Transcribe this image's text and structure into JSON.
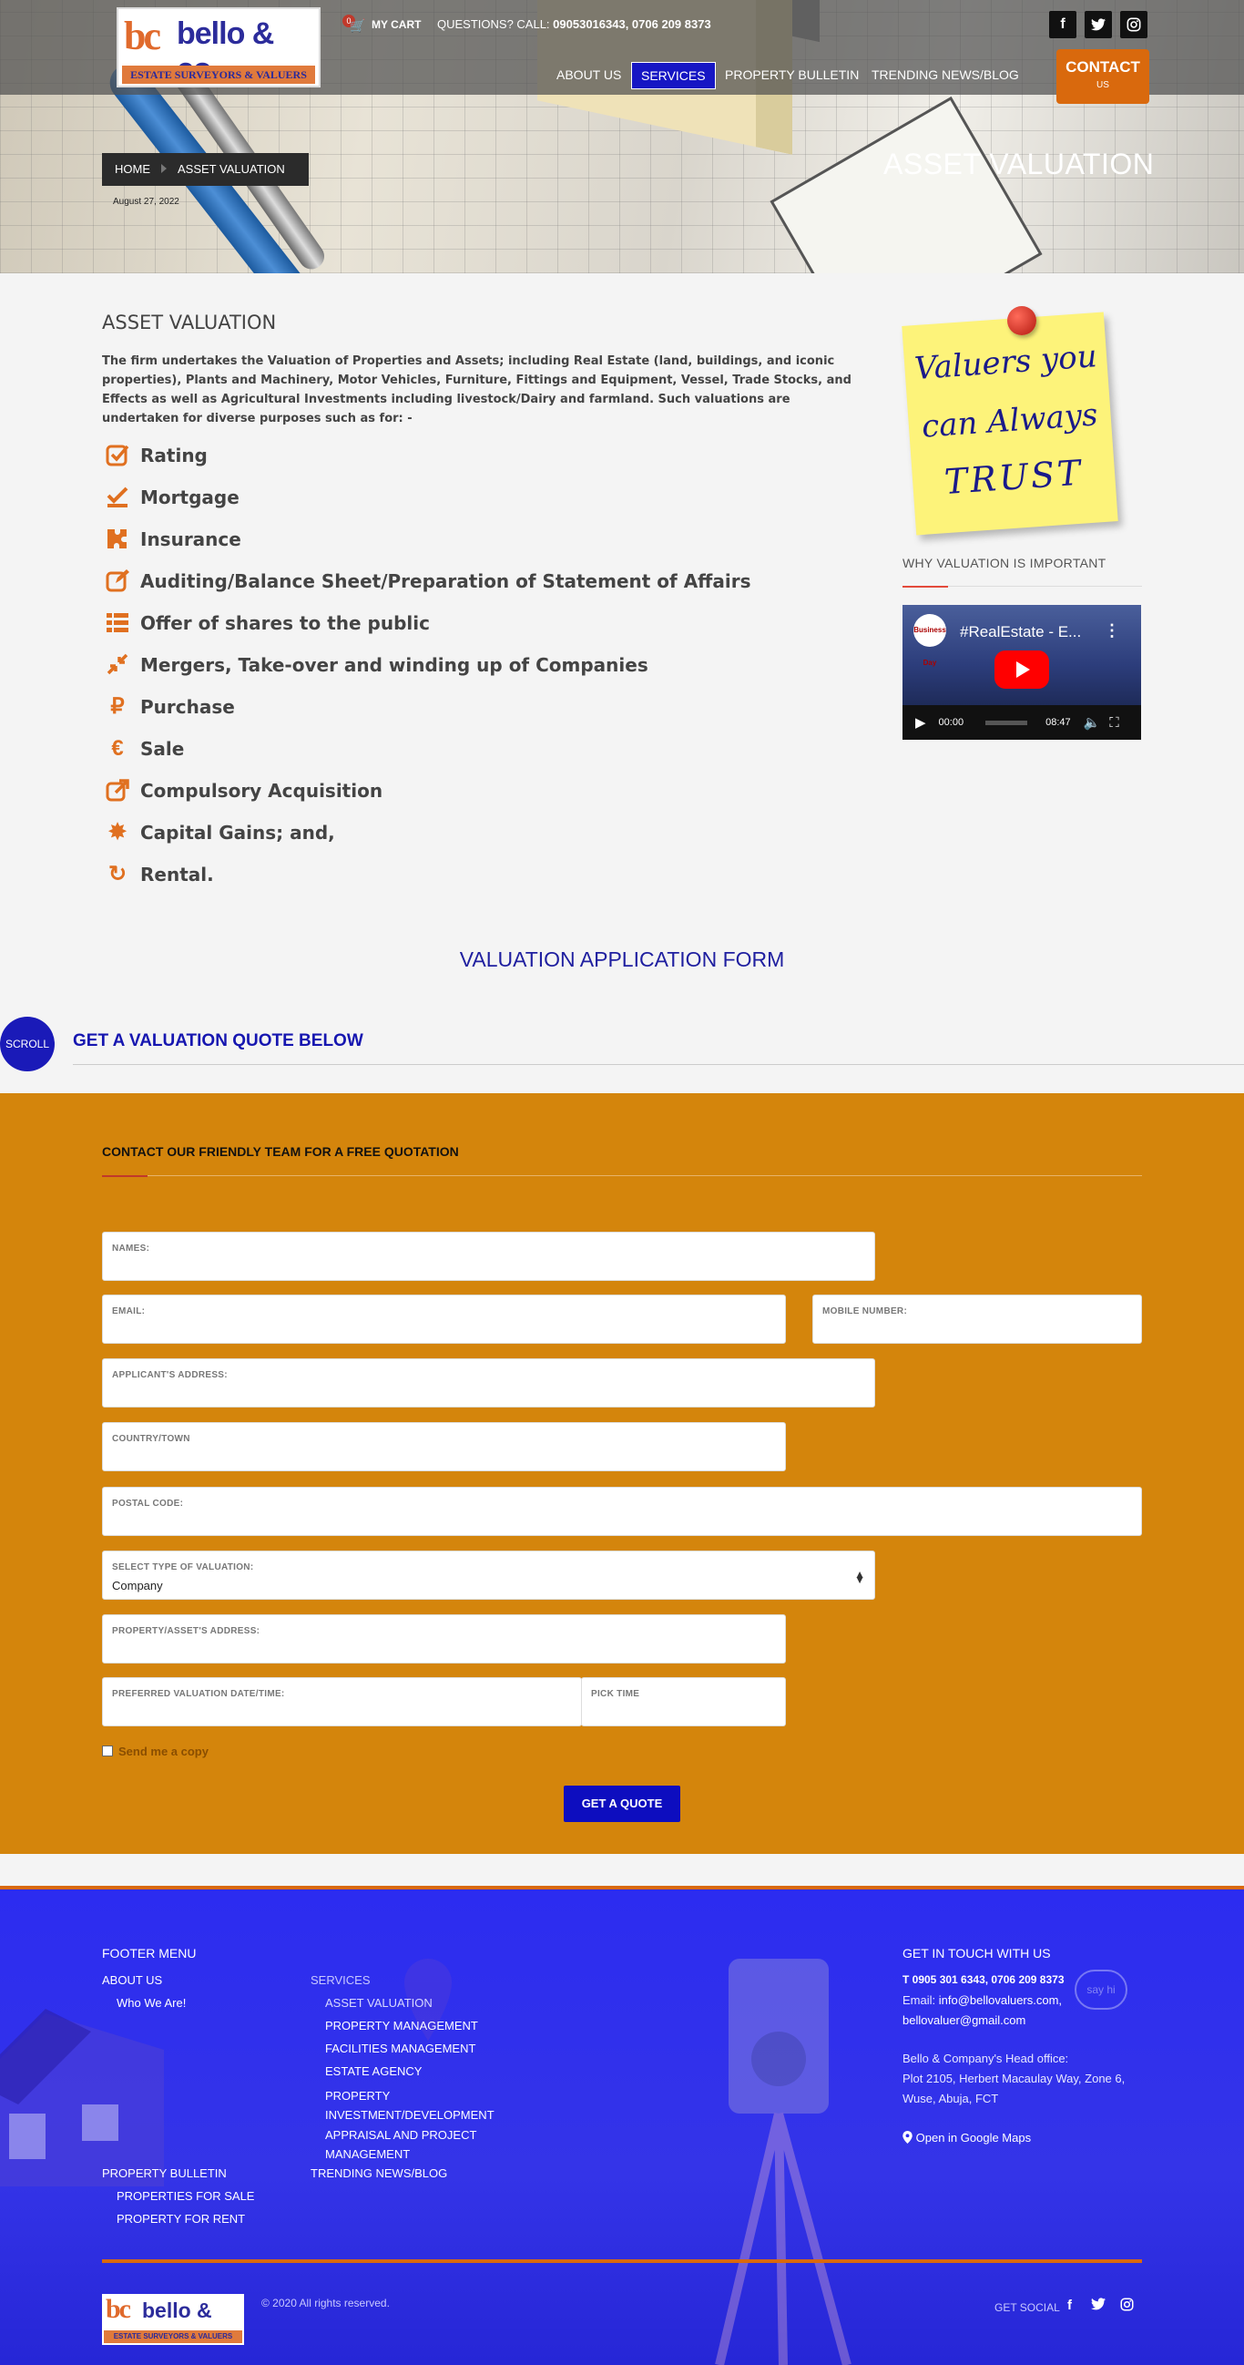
{
  "header": {
    "logo": {
      "monogram": "bc",
      "name": "bello & co.",
      "tagline": "ESTATE SURVEYORS & VALUERS"
    },
    "cart": {
      "count": "0",
      "label": "MY CART"
    },
    "questions_prefix": "QUESTIONS? CALL:",
    "phones": "09053016343, 0706 209 8373",
    "social": [
      "f",
      "t",
      "ig"
    ],
    "nav": [
      "ABOUT US",
      "SERVICES",
      "PROPERTY BULLETIN",
      "TRENDING NEWS/BLOG"
    ],
    "contact_line1": "CONTACT",
    "contact_line2": "US"
  },
  "hero": {
    "breadcrumb": [
      "HOME",
      "ASSET VALUATION"
    ],
    "date": "August 27, 2022",
    "title": "ASSET VALUATION"
  },
  "content": {
    "title": "ASSET VALUATION",
    "intro": "The firm undertakes the Valuation of Properties and Assets; including Real Estate (land, buildings, and iconic properties), Plants and Machinery, Motor Vehicles, Furniture, Fittings and Equipment, Vessel, Trade Stocks, and Effects as well as Agricultural Investments including livestock/Dairy and farmland. Such valuations are undertaken for diverse purposes such as for: -",
    "purposes": [
      {
        "icon": "check-square-icon",
        "text": "Rating"
      },
      {
        "icon": "check-underline-icon",
        "text": "Mortgage"
      },
      {
        "icon": "puzzle-icon",
        "text": "Insurance"
      },
      {
        "icon": "edit-icon",
        "text": "Auditing/Balance Sheet/Preparation of Statement of Affairs"
      },
      {
        "icon": "list-icon",
        "text": "Offer of shares to the public"
      },
      {
        "icon": "compress-icon",
        "text": "Mergers, Take-over and winding up of Companies"
      },
      {
        "icon": "ruble-icon",
        "text": "Purchase"
      },
      {
        "icon": "euro-icon",
        "text": "Sale"
      },
      {
        "icon": "share-square-icon",
        "text": "Compulsory Acquisition"
      },
      {
        "icon": "asterisk-icon",
        "text": "Capital Gains; and,"
      },
      {
        "icon": "refresh-icon",
        "text": "Rental."
      }
    ]
  },
  "sidebar": {
    "note_lines": [
      "Valuers you",
      "can Always",
      "TRUST"
    ],
    "why_title": "WHY VALUATION IS IMPORTANT",
    "video": {
      "channel": "Business Day",
      "title": "#RealEstate - E...",
      "current": "00:00",
      "duration": "08:47"
    }
  },
  "form_section": {
    "title": "VALUATION APPLICATION FORM",
    "scroll_label": "SCROLL",
    "quote_heading": "GET A VALUATION QUOTE BELOW",
    "team_heading": "CONTACT OUR FRIENDLY TEAM FOR A FREE QUOTATION",
    "fields": {
      "names": "NAMES:",
      "email": "EMAIL:",
      "mobile": "MOBILE NUMBER:",
      "address": "APPLICANT'S ADDRESS:",
      "country": "COUNTRY/TOWN",
      "postal": "POSTAL CODE:",
      "type": "SELECT TYPE OF VALUATION:",
      "type_value": "Company",
      "property": "PROPERTY/ASSET'S ADDRESS:",
      "date": "PREFERRED VALUATION DATE/TIME:",
      "time": "PICK TIME"
    },
    "copy_label": "Send me a copy",
    "submit": "GET A QUOTE"
  },
  "footer": {
    "menu_title": "FOOTER MENU",
    "about": "ABOUT US",
    "who": "Who We Are!",
    "services": "SERVICES",
    "service_items": [
      "ASSET VALUATION",
      "PROPERTY MANAGEMENT",
      "FACILITIES MANAGEMENT",
      "ESTATE AGENCY",
      "PROPERTY INVESTMENT/DEVELOPMENT",
      "APPRAISAL AND PROJECT MANAGEMENT"
    ],
    "bulletin": "PROPERTY BULLETIN",
    "sale": "PROPERTIES FOR SALE",
    "rent": "PROPERTY FOR RENT",
    "news": "TRENDING NEWS/BLOG",
    "touch_title": "GET IN TOUCH WITH US",
    "phones": "T 0905 301 6343, 0706 209 8373",
    "email_prefix": "Email: ",
    "email1": "info@bellovaluers.com,",
    "email2": "bellovaluer@gmail.com",
    "office_title": "Bello & Company's Head office:",
    "office_addr1": "Plot 2105, Herbert Macaulay Way, Zone 6,",
    "office_addr2": "Wuse, Abuja, FCT",
    "maps": "Open in Google Maps",
    "sayhi": "say hi",
    "copyright": "© 2020 All rights reserved.",
    "get_social": "GET SOCIAL"
  },
  "colors": {
    "accent": "#d9690d",
    "nav_active": "#1616c4",
    "form_bg": "#d4850c",
    "footer_bg": "#2c2cf0"
  }
}
